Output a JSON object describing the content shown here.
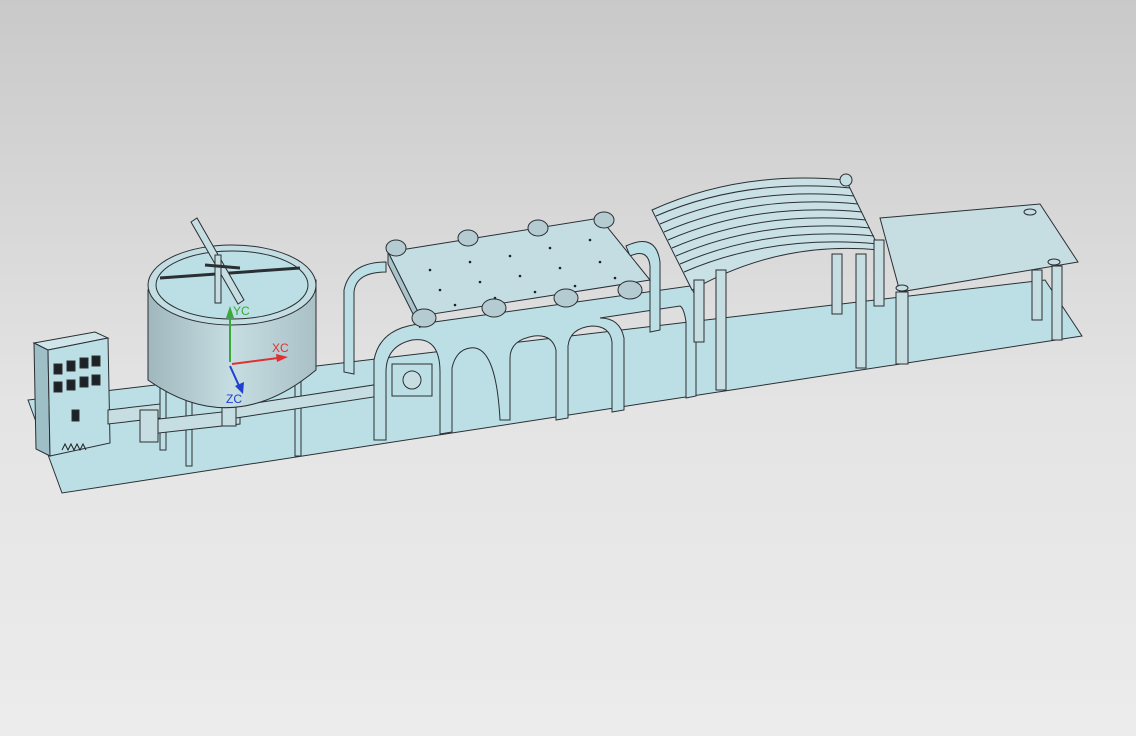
{
  "triad": {
    "yc_label": "YC",
    "xc_label": "XC",
    "zc_label": "ZC",
    "yc_color": "#3aa83a",
    "xc_color": "#e03030",
    "zc_color": "#2040d0"
  },
  "model": {
    "fill_color": "#bcdfe6",
    "edge_color": "#2a2f33",
    "parts": [
      "control-cabinet",
      "mixing-tank",
      "agitator",
      "piping",
      "perforated-conveyor",
      "curved-slat-guide",
      "output-table",
      "base-plate"
    ]
  }
}
